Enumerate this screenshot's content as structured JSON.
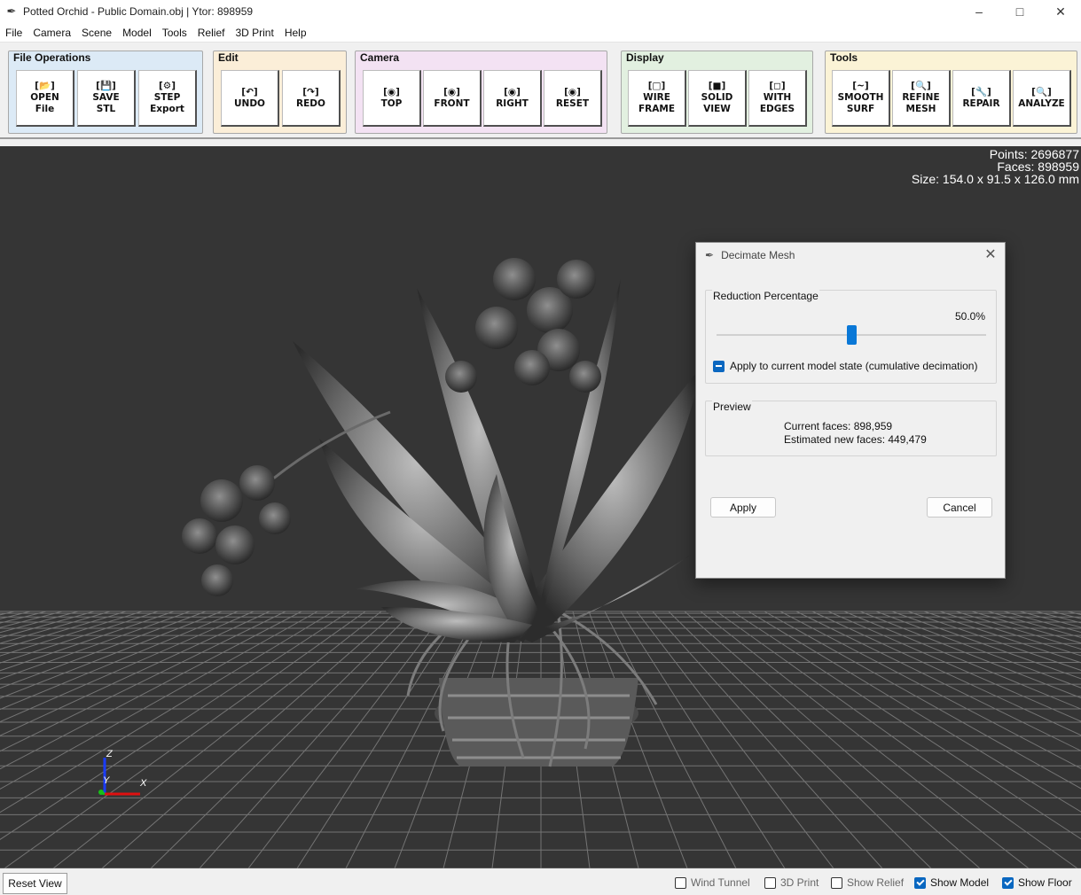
{
  "window": {
    "title": "Potted Orchid - Public Domain.obj | Ytor: 898959",
    "app_icon": "feather-icon",
    "controls": [
      "minimize-icon",
      "maximize-icon",
      "close-icon"
    ]
  },
  "menu": {
    "items": [
      "File",
      "Camera",
      "Scene",
      "Model",
      "Tools",
      "Relief",
      "3D Print",
      "Help"
    ]
  },
  "toolbar": {
    "groups": [
      {
        "title": "File Operations",
        "color": "#dceaf6",
        "buttons": [
          {
            "icon": "[📂]",
            "line1": "OPEN",
            "line2": "File"
          },
          {
            "icon": "[💾]",
            "line1": "SAVE",
            "line2": "STL"
          },
          {
            "icon": "[⚙]",
            "line1": "STEP",
            "line2": "Export"
          }
        ]
      },
      {
        "title": "Edit",
        "color": "#fbeed8",
        "buttons": [
          {
            "icon": "[↶]",
            "line1": "UNDO",
            "line2": ""
          },
          {
            "icon": "[↷]",
            "line1": "REDO",
            "line2": ""
          }
        ]
      },
      {
        "title": "Camera",
        "color": "#f3e2f3",
        "buttons": [
          {
            "icon": "[◉]",
            "line1": "TOP",
            "line2": ""
          },
          {
            "icon": "[◉]",
            "line1": "FRONT",
            "line2": ""
          },
          {
            "icon": "[◉]",
            "line1": "RIGHT",
            "line2": ""
          },
          {
            "icon": "[◉]",
            "line1": "RESET",
            "line2": ""
          }
        ]
      },
      {
        "title": "Display",
        "color": "#e2f0e0",
        "buttons": [
          {
            "icon": "[□]",
            "line1": "WIRE",
            "line2": "FRAME"
          },
          {
            "icon": "[■]",
            "line1": "SOLID",
            "line2": "VIEW"
          },
          {
            "icon": "[◻]",
            "line1": "WITH",
            "line2": "EDGES"
          }
        ]
      },
      {
        "title": "Tools",
        "color": "#fbf3d6",
        "buttons": [
          {
            "icon": "[~]",
            "line1": "SMOOTH",
            "line2": "SURF"
          },
          {
            "icon": "[🔍]",
            "line1": "REFINE",
            "line2": "MESH"
          },
          {
            "icon": "[🔧]",
            "line1": "REPAIR",
            "line2": ""
          },
          {
            "icon": "[🔍]",
            "line1": "ANALYZE",
            "line2": ""
          }
        ]
      }
    ]
  },
  "viewport": {
    "stats": {
      "points": "Points: 2696877",
      "faces": "Faces: 898959",
      "size": "Size: 154.0 x 91.5 x 126.0 mm"
    },
    "axes": {
      "z": "Z",
      "y": "Y",
      "x": "X"
    },
    "background": "#353535"
  },
  "dialog": {
    "title": "Decimate Mesh",
    "reduction_legend": "Reduction Percentage",
    "percentage": "50.0%",
    "slider_fraction": 0.5,
    "cumulative_label": "Apply to current model state (cumulative decimation)",
    "preview_legend": "Preview",
    "current_faces": "Current faces: 898,959",
    "estimated_faces": "Estimated new faces: 449,479",
    "apply_label": "Apply",
    "cancel_label": "Cancel",
    "accent": "#0a78d7"
  },
  "statusbar": {
    "reset_view": "Reset View",
    "toggles": [
      {
        "label": "Wind Tunnel",
        "checked": false
      },
      {
        "label": "3D Print",
        "checked": false
      },
      {
        "label": "Show Relief",
        "checked": false
      },
      {
        "label": "Show Model",
        "checked": true
      },
      {
        "label": "Show Floor",
        "checked": true
      }
    ]
  }
}
